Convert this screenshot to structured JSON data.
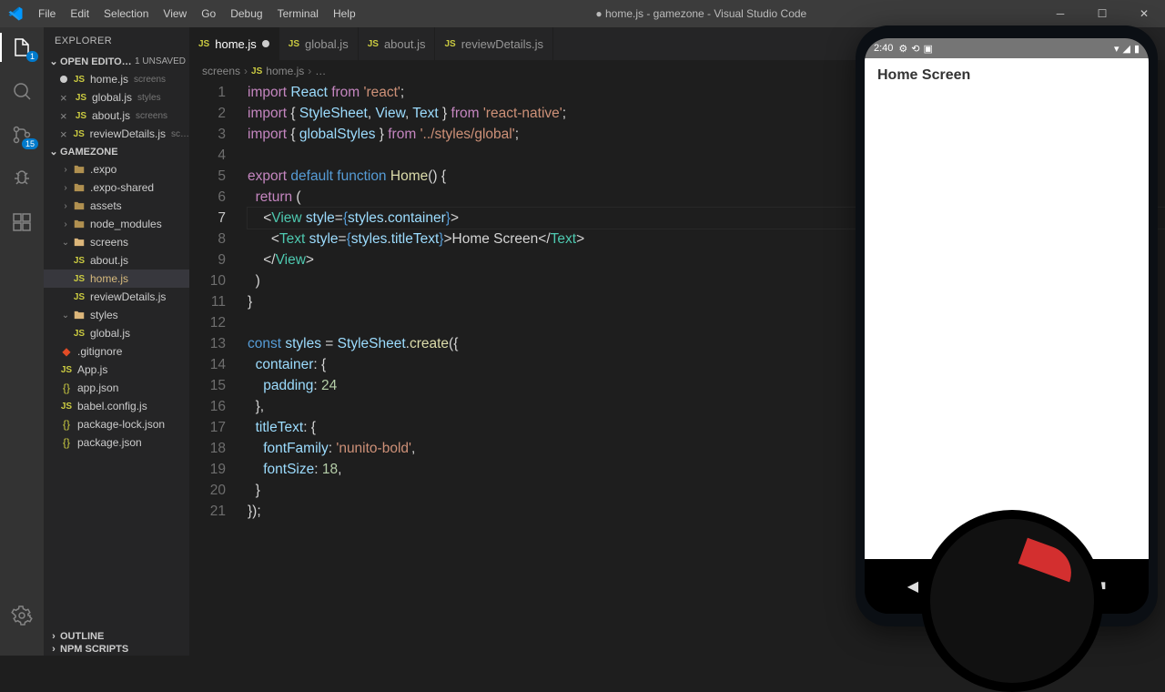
{
  "window": {
    "title": "● home.js - gamezone - Visual Studio Code",
    "menu": [
      "File",
      "Edit",
      "Selection",
      "View",
      "Go",
      "Debug",
      "Terminal",
      "Help"
    ]
  },
  "activitybar": {
    "explorer_badge": "1",
    "scm_badge": "15"
  },
  "sidebar": {
    "title": "EXPLORER",
    "openEditors": {
      "label": "OPEN EDITO…",
      "badge": "1 UNSAVED",
      "items": [
        {
          "name": "home.js",
          "tag": "screens",
          "unsaved": true
        },
        {
          "name": "global.js",
          "tag": "styles"
        },
        {
          "name": "about.js",
          "tag": "screens"
        },
        {
          "name": "reviewDetails.js",
          "tag": "sc…"
        }
      ]
    },
    "project": {
      "label": "GAMEZONE",
      "tree": [
        {
          "type": "folder",
          "name": ".expo",
          "d": 1
        },
        {
          "type": "folder",
          "name": ".expo-shared",
          "d": 1
        },
        {
          "type": "folder",
          "name": "assets",
          "d": 1
        },
        {
          "type": "folder",
          "name": "node_modules",
          "d": 1
        },
        {
          "type": "folder",
          "name": "screens",
          "d": 1,
          "open": true
        },
        {
          "type": "js",
          "name": "about.js",
          "d": 2
        },
        {
          "type": "js",
          "name": "home.js",
          "d": 2,
          "selected": true,
          "modified": true
        },
        {
          "type": "js",
          "name": "reviewDetails.js",
          "d": 2
        },
        {
          "type": "folder",
          "name": "styles",
          "d": 1,
          "open": true
        },
        {
          "type": "js",
          "name": "global.js",
          "d": 2
        },
        {
          "type": "git",
          "name": ".gitignore",
          "d": 1
        },
        {
          "type": "js",
          "name": "App.js",
          "d": 1
        },
        {
          "type": "json",
          "name": "app.json",
          "d": 1
        },
        {
          "type": "js",
          "name": "babel.config.js",
          "d": 1
        },
        {
          "type": "json",
          "name": "package-lock.json",
          "d": 1
        },
        {
          "type": "json",
          "name": "package.json",
          "d": 1
        }
      ]
    },
    "outline": "OUTLINE",
    "npm": "NPM SCRIPTS"
  },
  "tabs": [
    {
      "name": "home.js",
      "active": true,
      "dirty": true
    },
    {
      "name": "global.js"
    },
    {
      "name": "about.js"
    },
    {
      "name": "reviewDetails.js"
    }
  ],
  "breadcrumb": [
    "screens",
    "home.js",
    "…"
  ],
  "code": {
    "lines": 21,
    "current": 7
  },
  "phone": {
    "time": "2:40",
    "heading": "Home Screen"
  },
  "chart_data": {
    "type": "table",
    "title": "home.js source",
    "rows": [
      "import React from 'react';",
      "import { StyleSheet, View, Text } from 'react-native';",
      "import { globalStyles } from '../styles/global';",
      "",
      "export default function Home() {",
      "  return (",
      "    <View style={styles.container}>",
      "      <Text style={styles.titleText}>Home Screen</Text>",
      "    </View>",
      "  )",
      "}",
      "",
      "const styles = StyleSheet.create({",
      "  container: {",
      "    padding: 24",
      "  },",
      "  titleText: {",
      "    fontFamily: 'nunito-bold',",
      "    fontSize: 18,",
      "  }",
      "});"
    ]
  }
}
